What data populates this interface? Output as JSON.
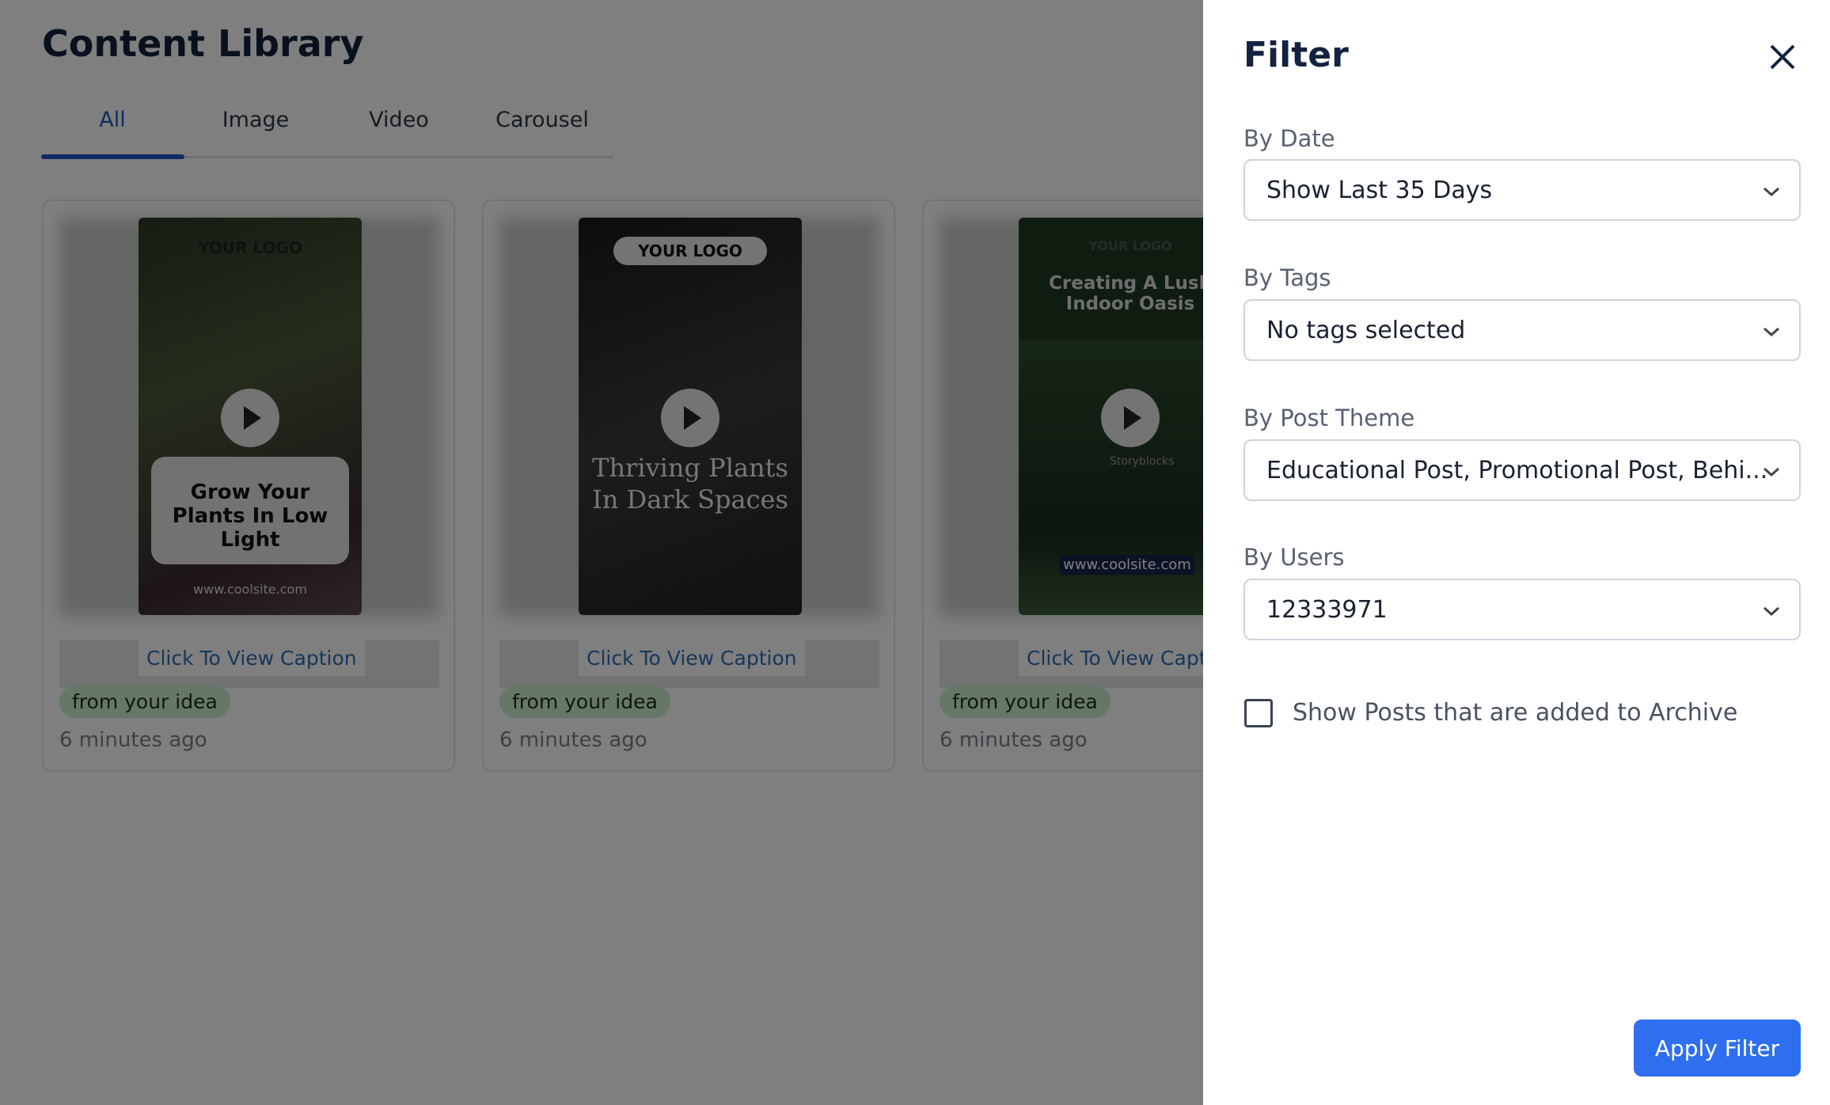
{
  "main": {
    "title": "Content Library",
    "tabs": [
      {
        "label": "All",
        "active": true
      },
      {
        "label": "Image"
      },
      {
        "label": "Video"
      },
      {
        "label": "Carousel"
      }
    ],
    "cards": [
      {
        "logo": "YOUR LOGO",
        "headline": "Grow Your Plants In Low Light",
        "site": "www.coolsite.com",
        "caption_link": "Click To View Caption",
        "badge": "from your idea",
        "time": "6 minutes ago"
      },
      {
        "logo": "YOUR LOGO",
        "headline": "Thriving Plants In Dark Spaces",
        "caption_link": "Click To View Caption",
        "badge": "from your idea",
        "time": "6 minutes ago"
      },
      {
        "logo": "YOUR LOGO",
        "headline": "Creating A Lush Indoor Oasis",
        "watermark": "Storyblocks",
        "site": "www.coolsite.com",
        "caption_link": "Click To View Caption",
        "badge": "from your idea",
        "time": "6 minutes ago"
      }
    ]
  },
  "filter": {
    "title": "Filter",
    "date": {
      "label": "By Date",
      "value": "Show Last 35 Days"
    },
    "tags": {
      "label": "By Tags",
      "value": "No tags selected"
    },
    "theme": {
      "label": "By Post Theme",
      "value": "Educational Post, Promotional Post, Behi..."
    },
    "users": {
      "label": "By Users",
      "value": "12333971"
    },
    "archive": {
      "label": "Show Posts that are added to Archive",
      "checked": false
    },
    "apply_label": "Apply Filter"
  },
  "colors": {
    "accent": "#2e6ff0",
    "tab_active": "#2357c9",
    "badge": "#cdeccf",
    "link": "#2f6fb6"
  }
}
